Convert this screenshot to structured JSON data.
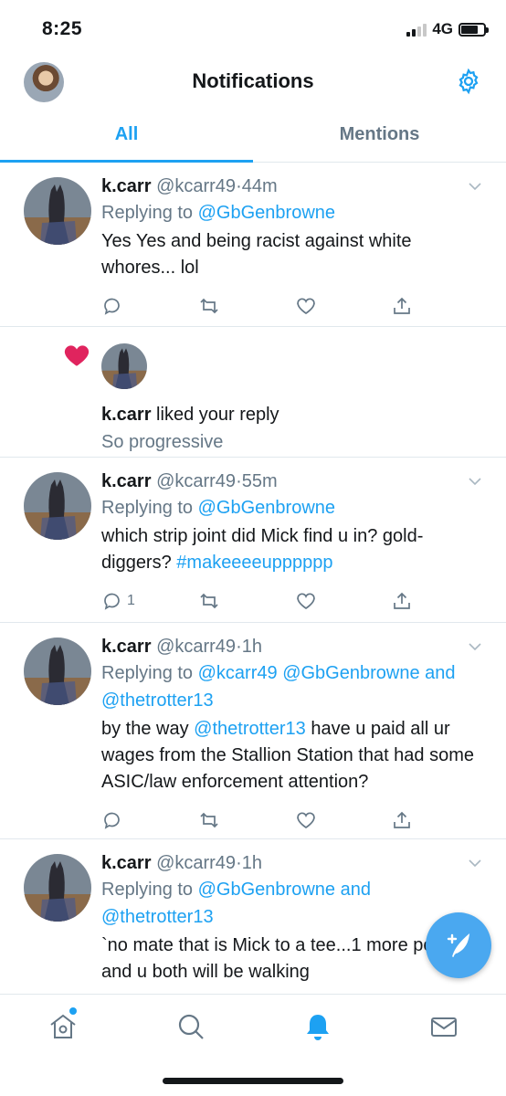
{
  "status_bar": {
    "time": "8:25",
    "network": "4G"
  },
  "header": {
    "title": "Notifications"
  },
  "tabs": [
    {
      "label": "All",
      "active": true
    },
    {
      "label": "Mentions",
      "active": false
    }
  ],
  "feed": {
    "tweet1": {
      "name": "k.carr",
      "handle": "@kcarr49",
      "separator": "·",
      "time": "44m",
      "replying_prefix": "Replying to ",
      "replying_to": "@GbGenbrowne",
      "text": "Yes Yes and being racist against white whores... lol",
      "reply_count": ""
    },
    "like": {
      "name": "k.carr",
      "action": " liked your reply",
      "subtext": "So progressive"
    },
    "tweet2": {
      "name": "k.carr",
      "handle": "@kcarr49",
      "separator": "·",
      "time": "55m",
      "replying_prefix": "Replying to ",
      "replying_to": "@GbGenbrowne",
      "text": "which strip joint did Mick find u in? gold-diggers? ",
      "hashtag": "#makeeeeupppppp",
      "reply_count": "1"
    },
    "tweet3": {
      "name": "k.carr",
      "handle": "@kcarr49",
      "separator": "·",
      "time": "1h",
      "replying_prefix": "Replying to ",
      "replying_to_1": "@kcarr49",
      "replying_to_2": "@GbGenbrowne",
      "and": " and",
      "replying_to_3": "@thetrotter13",
      "text_before": "by the way ",
      "mention": "@thetrotter13",
      "text_after": " have u paid all ur wages from the Stallion Station that had some ASIC/law enforcement attention?"
    },
    "tweet4": {
      "name": "k.carr",
      "handle": "@kcarr49",
      "separator": "·",
      "time": "1h",
      "replying_prefix": "Replying to ",
      "replying_to_1": "@GbGenbrowne",
      "and": " and",
      "replying_to_2": "@thetrotter13",
      "text": "`no mate that is Mick to a tee...1 more positive and u both will be walking"
    }
  },
  "colors": {
    "accent": "#1da1f2",
    "muted": "#657786",
    "like": "#e0245e",
    "text": "#14171a"
  },
  "icons": {
    "gear": "gear-icon",
    "reply": "reply-icon",
    "retweet": "retweet-icon",
    "like": "heart-icon",
    "share": "share-icon",
    "compose": "compose-icon",
    "home": "home-icon",
    "search": "search-icon",
    "notifications": "bell-icon",
    "messages": "mail-icon"
  }
}
